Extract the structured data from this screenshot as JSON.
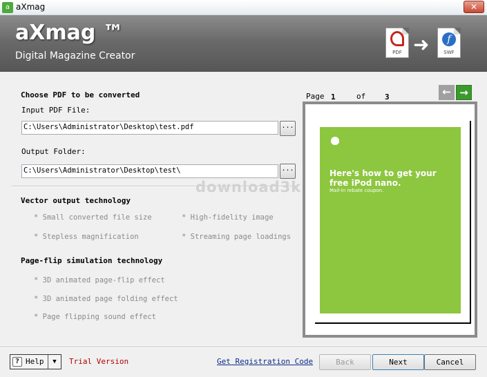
{
  "window": {
    "title": "aXmag",
    "close_label": "✕"
  },
  "banner": {
    "brand": "aXmag ™",
    "tagline": "Digital Magazine Creator",
    "pdf_tag": "PDF",
    "swf_tag": "SWF",
    "swf_glyph": "f",
    "arrow": "➜"
  },
  "form": {
    "section_title": "Choose PDF to be converted",
    "input_label": "Input PDF File:",
    "input_value": "C:\\Users\\Administrator\\Desktop\\test.pdf",
    "output_label": "Output Folder:",
    "output_value": "C:\\Users\\Administrator\\Desktop\\test\\",
    "browse_label": "..."
  },
  "watermark": "download3k",
  "features": {
    "vector_title": "Vector output technology",
    "vector_items": [
      "* Small converted file size",
      "* High-fidelity image",
      "* Stepless magnification",
      "* Streaming page loadings"
    ],
    "flip_title": "Page-flip simulation technology",
    "flip_items": [
      "* 3D animated page-flip effect",
      "* 3D animated page folding effect",
      "* Page flipping sound effect"
    ]
  },
  "pager": {
    "page_label": "Page",
    "current_page": "1",
    "of_label": "of",
    "total_pages": "3",
    "prev_glyph": "←",
    "next_glyph": "→"
  },
  "preview": {
    "headline": "Here's how to get your free iPod nano.",
    "subline": "Mail-in rebate coupon."
  },
  "footer": {
    "help_icon": "?",
    "help_label": "Help",
    "help_drop": "▼",
    "trial_text": "Trial Version",
    "registration_link": "Get Registration Code",
    "back_label": "Back",
    "next_label": "Next",
    "cancel_label": "Cancel"
  }
}
